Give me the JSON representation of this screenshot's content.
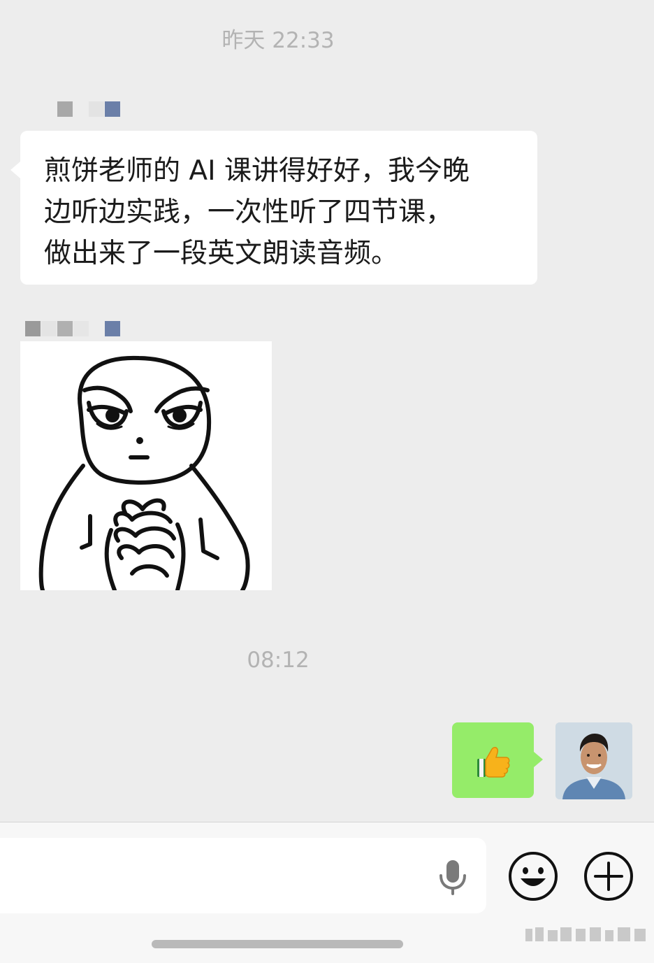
{
  "timestamps": {
    "first": "昨天 22:33",
    "second": "08:12"
  },
  "incoming_message": {
    "lines": [
      "煎饼老师的 AI 课讲得好好，我今晚",
      "边听边实践，一次性听了四节课，",
      "做出来了一段英文朗读音频。"
    ]
  },
  "incoming_sticker": {
    "icon": "praying-hands-cartoon"
  },
  "outgoing_message": {
    "emoji": "thumbs-up-emoji"
  },
  "colors": {
    "chat_background": "#ededed",
    "incoming_bubble": "#ffffff",
    "outgoing_bubble": "#95ec69",
    "timestamp_text": "#b3b3b3"
  },
  "input_bar": {
    "voice_icon": "microphone-icon",
    "emoji_icon": "smiley-icon",
    "more_icon": "plus-circle-icon"
  }
}
